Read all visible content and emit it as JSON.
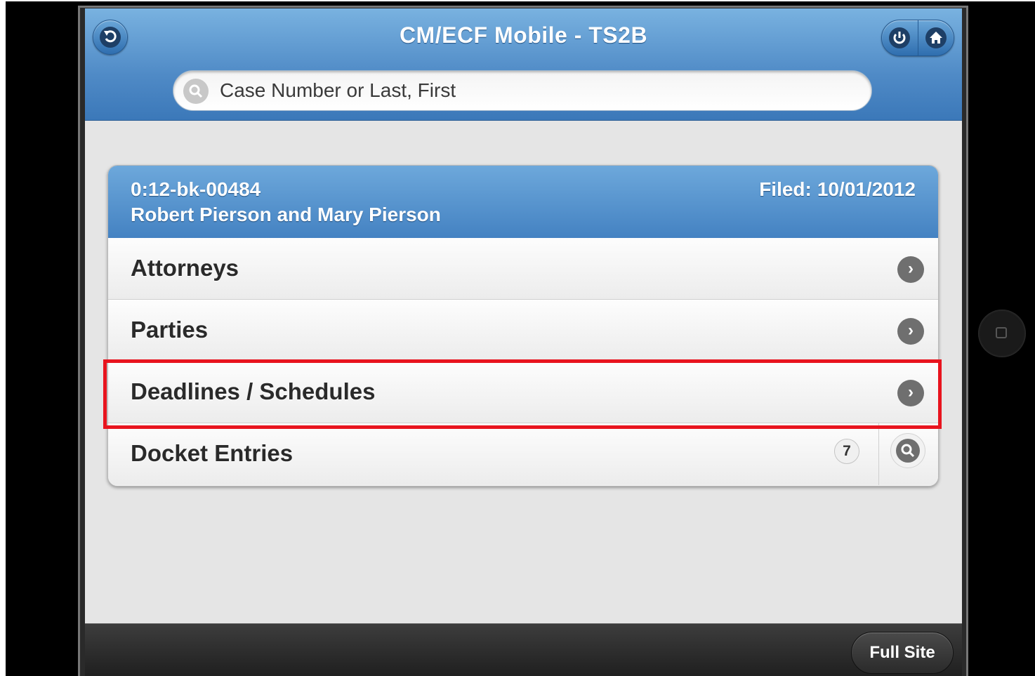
{
  "header": {
    "title": "CM/ECF Mobile - TS2B",
    "back_icon": "back-arrow-icon",
    "power_icon": "power-icon",
    "home_icon": "home-icon"
  },
  "search": {
    "placeholder": "Case Number or Last, First",
    "value": ""
  },
  "case": {
    "number": "0:12-bk-00484",
    "names": "Robert Pierson and Mary Pierson",
    "filed_label": "Filed:",
    "filed_date": "10/01/2012"
  },
  "menu": {
    "items": [
      {
        "label": "Attorneys"
      },
      {
        "label": "Parties"
      },
      {
        "label": "Deadlines / Schedules",
        "highlighted": true
      },
      {
        "label": "Docket Entries",
        "count": "7"
      }
    ]
  },
  "footer": {
    "full_site_label": "Full Site"
  },
  "colors": {
    "header_blue": "#4f8ac6",
    "highlight_red": "#e8141e",
    "footer_dark": "#2a2a2a"
  }
}
